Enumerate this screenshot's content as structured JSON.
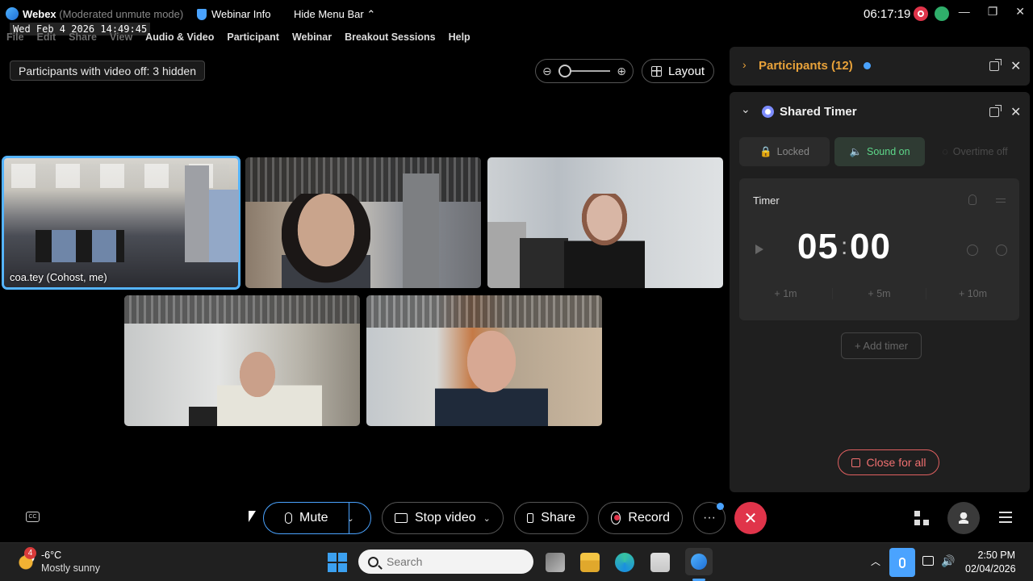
{
  "titlebar": {
    "app_name": "Webex",
    "mode": "(Moderated unmute mode)",
    "webinar_info": "Webinar Info",
    "hide_menu": "Hide Menu Bar",
    "clock": "06:17:19",
    "minimize": "—",
    "restore": "❐",
    "close": "✕"
  },
  "overlay_timestamp": "Wed Feb 4 2026 14:49:45",
  "menubar": {
    "items": [
      "File",
      "Edit",
      "Share",
      "View",
      "Audio & Video",
      "Participant",
      "Webinar",
      "Breakout Sessions",
      "Help"
    ]
  },
  "stage": {
    "hidden_note": "Participants with video off: 3 hidden",
    "zoom_out": "⊖",
    "zoom_in": "⊕",
    "zoom_level": 0,
    "layout_label": "Layout",
    "tiles": [
      {
        "name": "coa.tey (Cohost, me)",
        "active": true
      },
      {
        "name": ""
      },
      {
        "name": ""
      },
      {
        "name": ""
      },
      {
        "name": ""
      }
    ]
  },
  "participants_panel": {
    "title": "Participants (12)",
    "chevron": "›",
    "close": "✕"
  },
  "timer_panel": {
    "title": "Shared Timer",
    "chevron": "⌄",
    "close": "✕",
    "chips": {
      "locked": "Locked",
      "sound": "Sound on",
      "overtime": "Overtime off"
    },
    "timer_label": "Timer",
    "minutes": "05",
    "colon": ":",
    "seconds": "00",
    "increments": [
      "+ 1m",
      "+ 5m",
      "+ 10m"
    ],
    "add_timer": "+ Add timer",
    "close_all": "Close for all"
  },
  "controls": {
    "mute": "Mute",
    "stop_video": "Stop video",
    "share": "Share",
    "record": "Record",
    "more": "···",
    "leave": "✕",
    "caret": "⌄"
  },
  "taskbar": {
    "weather_badge": "4",
    "temperature": "-6°C",
    "weather_desc": "Mostly sunny",
    "search_placeholder": "Search",
    "tray_up": "︿",
    "volume": "🔊",
    "time": "2:50 PM",
    "date": "02/04/2026"
  },
  "colors": {
    "accent_blue": "#4aa3ff",
    "participants_orange": "#e8a23a",
    "sound_on_green": "#5ed88a",
    "leave_red": "#e0344a"
  }
}
